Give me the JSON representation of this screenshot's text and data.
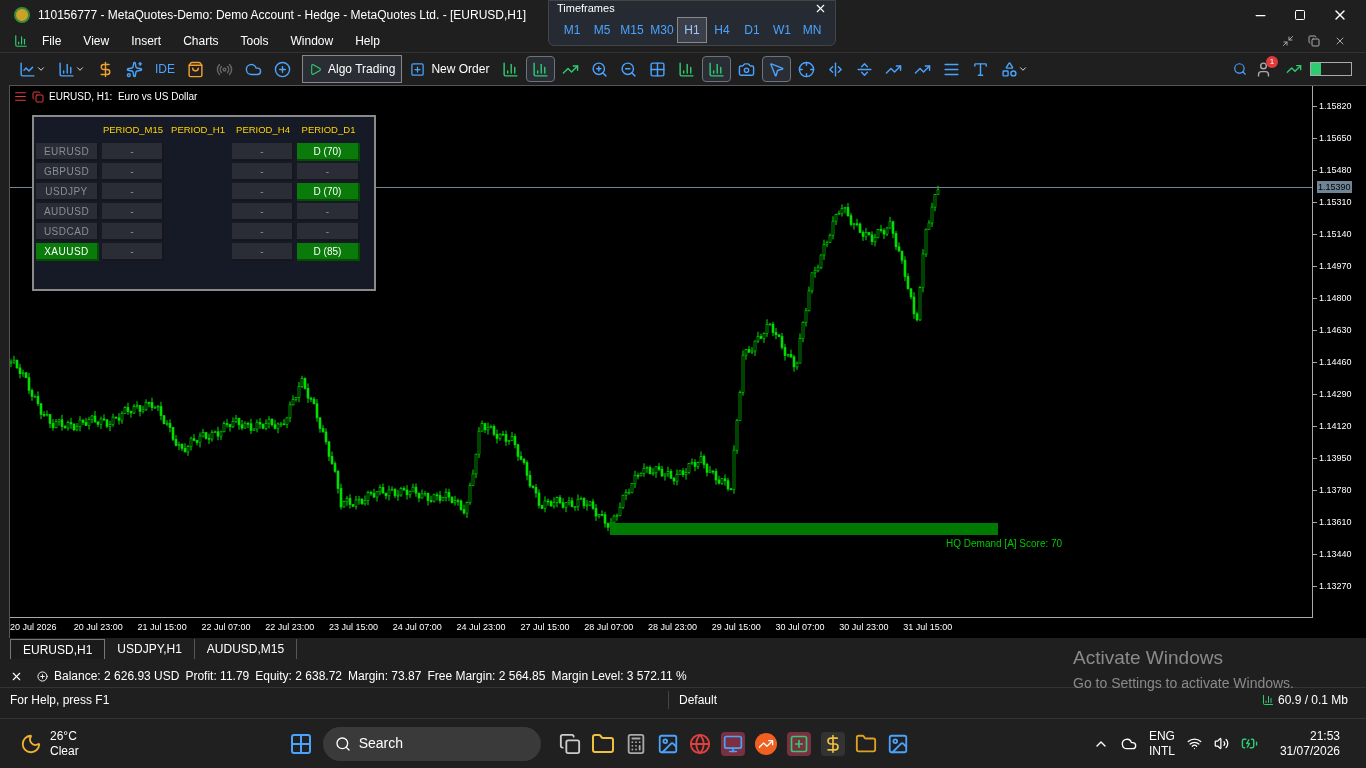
{
  "window": {
    "title": "110156777 - MetaQuotes-Demo: Demo Account - Hedge - MetaQuotes Ltd. - [EURUSD,H1]"
  },
  "menu": [
    "File",
    "View",
    "Insert",
    "Charts",
    "Tools",
    "Window",
    "Help"
  ],
  "timeframes": {
    "title": "Timeframes",
    "items": [
      {
        "label": "M1",
        "selected": false
      },
      {
        "label": "M5",
        "selected": false
      },
      {
        "label": "M15",
        "selected": false
      },
      {
        "label": "M30",
        "selected": false
      },
      {
        "label": "H1",
        "selected": true
      },
      {
        "label": "H4",
        "selected": false
      },
      {
        "label": "D1",
        "selected": false
      },
      {
        "label": "W1",
        "selected": false
      },
      {
        "label": "MN",
        "selected": false
      }
    ]
  },
  "toolbar": {
    "ide": "IDE",
    "algo_trading": "Algo Trading",
    "new_order": "New Order",
    "notifications": "1"
  },
  "chart": {
    "title": "EURUSD, H1:  Euro vs US Dollar",
    "current_price": "1.15390",
    "zone_label": "HQ Demand [A] Score: 70",
    "price_ticks": [
      "1.15820",
      "1.15650",
      "1.15480",
      "1.15310",
      "1.15140",
      "1.14970",
      "1.14800",
      "1.14630",
      "1.14460",
      "1.14290",
      "1.14120",
      "1.13950",
      "1.13780",
      "1.13610",
      "1.13440",
      "1.13270"
    ],
    "time_ticks": [
      "20 Jul 2026",
      "20 Jul 23:00",
      "21 Jul 15:00",
      "22 Jul 07:00",
      "22 Jul 23:00",
      "23 Jul 15:00",
      "24 Jul 07:00",
      "24 Jul 23:00",
      "27 Jul 15:00",
      "28 Jul 07:00",
      "28 Jul 23:00",
      "29 Jul 15:00",
      "30 Jul 07:00",
      "30 Jul 23:00",
      "31 Jul 15:00"
    ]
  },
  "panel": {
    "columns": [
      "PERIOD_M15",
      "PERIOD_H1",
      "PERIOD_H4",
      "PERIOD_D1"
    ],
    "rows": [
      {
        "symbol": "EURUSD",
        "selected": false,
        "cells": [
          {
            "kind": "button",
            "text": "-",
            "on": false
          },
          {
            "kind": "blank"
          },
          {
            "kind": "button",
            "text": "-",
            "on": false
          },
          {
            "kind": "button",
            "text": "D (70)",
            "on": true
          }
        ]
      },
      {
        "symbol": "GBPUSD",
        "selected": false,
        "cells": [
          {
            "kind": "button",
            "text": "-",
            "on": false
          },
          {
            "kind": "blank"
          },
          {
            "kind": "button",
            "text": "-",
            "on": false
          },
          {
            "kind": "button",
            "text": "-",
            "on": false
          }
        ]
      },
      {
        "symbol": "USDJPY",
        "selected": false,
        "cells": [
          {
            "kind": "button",
            "text": "-",
            "on": false
          },
          {
            "kind": "blank"
          },
          {
            "kind": "button",
            "text": "-",
            "on": false
          },
          {
            "kind": "button",
            "text": "D (70)",
            "on": true
          }
        ]
      },
      {
        "symbol": "AUDUSD",
        "selected": false,
        "cells": [
          {
            "kind": "button",
            "text": "-",
            "on": false
          },
          {
            "kind": "blank"
          },
          {
            "kind": "button",
            "text": "-",
            "on": false
          },
          {
            "kind": "button",
            "text": "-",
            "on": false
          }
        ]
      },
      {
        "symbol": "USDCAD",
        "selected": false,
        "cells": [
          {
            "kind": "button",
            "text": "-",
            "on": false
          },
          {
            "kind": "blank"
          },
          {
            "kind": "button",
            "text": "-",
            "on": false
          },
          {
            "kind": "button",
            "text": "-",
            "on": false
          }
        ]
      },
      {
        "symbol": "XAUUSD",
        "selected": true,
        "cells": [
          {
            "kind": "button",
            "text": "-",
            "on": false
          },
          {
            "kind": "blank"
          },
          {
            "kind": "button",
            "text": "-",
            "on": false
          },
          {
            "kind": "button",
            "text": "D (85)",
            "on": true
          }
        ]
      }
    ]
  },
  "tabs": [
    {
      "label": "EURUSD,H1",
      "selected": true
    },
    {
      "label": "USDJPY,H1",
      "selected": false
    },
    {
      "label": "AUDUSD,M15",
      "selected": false
    }
  ],
  "account": [
    "Balance: 2 626.93 USD",
    "Profit: 11.79",
    "Equity: 2 638.72",
    "Margin: 73.87",
    "Free Margin: 2 564.85",
    "Margin Level: 3 572.11 %"
  ],
  "activation": {
    "title": "Activate Windows",
    "text": "Go to Settings to activate Windows."
  },
  "status_bar": {
    "help": "For Help, press F1",
    "profile": "Default",
    "traffic": "60.9 / 0.1 Mb"
  },
  "taskbar": {
    "temperature": "26°C",
    "weather": "Clear",
    "search": "Search",
    "language": [
      "ENG",
      "INTL"
    ],
    "time": "21:53",
    "date": "31/07/2026"
  }
}
